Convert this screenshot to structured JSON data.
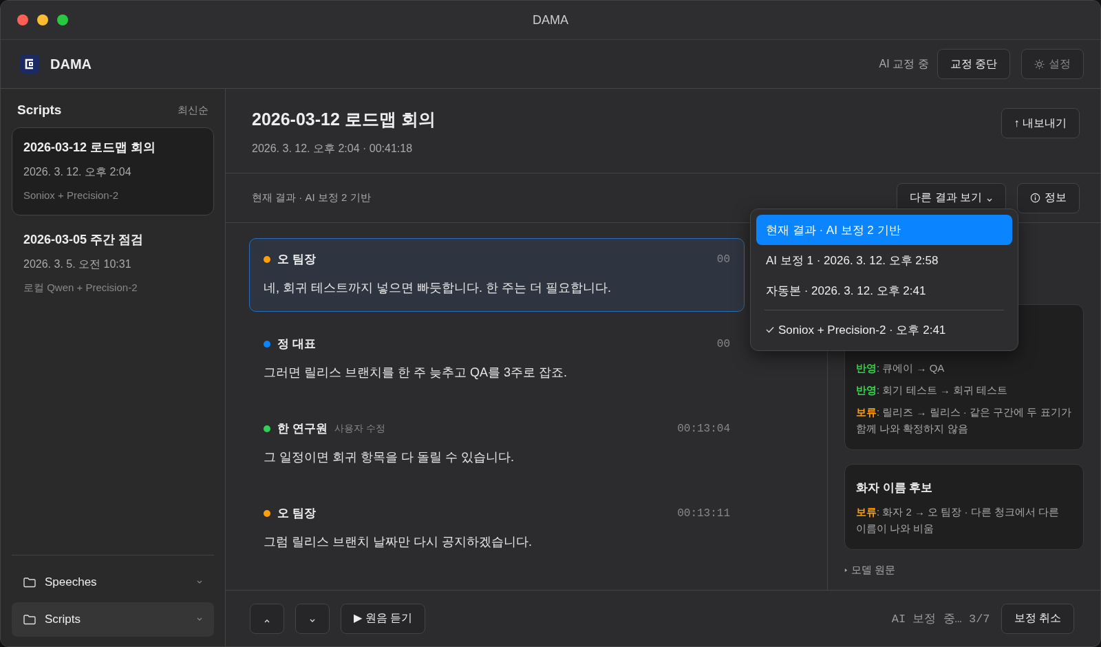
{
  "window": {
    "title": "DAMA"
  },
  "app": {
    "name": "DAMA",
    "status": "AI 교정 중",
    "stop_button": "교정 중단",
    "settings_button": {
      "label": "설정",
      "disabled": true
    }
  },
  "sidebar": {
    "title": "Scripts",
    "sort": "최신순",
    "scripts": [
      {
        "title": "2026-03-12 로드맵 회의",
        "date": "2026. 3. 12. 오후 2:04",
        "engine": "Soniox + Precision-2",
        "selected": true
      },
      {
        "title": "2026-03-05 주간 점검",
        "date": "2026. 3. 5. 오전 10:31",
        "engine": "로컬 Qwen + Precision-2",
        "selected": false
      }
    ],
    "folders": [
      {
        "label": "Speeches",
        "selected": false
      },
      {
        "label": "Scripts",
        "selected": true
      }
    ]
  },
  "document": {
    "title": "2026-03-12 로드맵 회의",
    "meta": "2026. 3. 12. 오후 2:04 · 00:41:18",
    "export_button": "↑ 내보내기"
  },
  "toolbar": {
    "current": "현재 결과 · AI 보정 2 기반",
    "other_results_button": "다른 결과 보기",
    "info_button": "정보"
  },
  "dropdown": {
    "sections": [
      [
        {
          "label": "현재 결과 · AI 보정 2 기반",
          "selected": true,
          "checked": false
        },
        {
          "label": "AI 보정 1 · 2026. 3. 12. 오후 2:58",
          "selected": false,
          "checked": false
        },
        {
          "label": "자동본 · 2026. 3. 12. 오후 2:41",
          "selected": false,
          "checked": false
        }
      ],
      [
        {
          "label": "Soniox + Precision-2 · 오후 2:41",
          "selected": false,
          "checked": true
        }
      ]
    ]
  },
  "segments": [
    {
      "speaker": "오 팀장",
      "color": "#ff9f0a",
      "time": "00",
      "text": "네, 회귀 테스트까지 넣으면 빠듯합니다. 한 주는 더 필요합니다.",
      "selected": true
    },
    {
      "speaker": "정 대표",
      "color": "#0a84ff",
      "time": "00",
      "text": "그러면 릴리스 브랜치를 한 주 늦추고 QA를 3주로 잡죠.",
      "selected": false
    },
    {
      "speaker": "한 연구원",
      "color": "#30d158",
      "note": "사용자 수정",
      "time": "00:13:04",
      "text": "그 일정이면 회귀 항목을 다 돌릴 수 있습니다.",
      "selected": false
    },
    {
      "speaker": "오 팀장",
      "color": "#ff9f0a",
      "time": "00:13:11",
      "text": "그럼 릴리스 브랜치 날짜만 다시 공지하겠습니다.",
      "selected": false
    }
  ],
  "review": {
    "cards": [
      {
        "items": [
          {
            "kind": "applied",
            "label": "반영",
            "text": ": 큐에이 → QA"
          },
          {
            "kind": "applied",
            "label": "반영",
            "text": ": 회기 테스트 → 회귀 테스트"
          },
          {
            "kind": "held",
            "label": "보류",
            "text": ": 릴리즈 → 릴리스 · 같은 구간에 두 표기가 함께 나와 확정하지 않음"
          }
        ]
      },
      {
        "title": "화자 이름 후보",
        "items": [
          {
            "kind": "held",
            "label": "보류",
            "text": ": 화자 2 → 오 팀장 · 다른 청크에서 다른 이름이 나와 비움"
          }
        ]
      }
    ],
    "raw_toggle": "모델 원문"
  },
  "footer": {
    "play_button": "▶ 원음 듣기",
    "progress": "AI 보정 중… 3/7",
    "cancel_button": "보정 취소"
  }
}
